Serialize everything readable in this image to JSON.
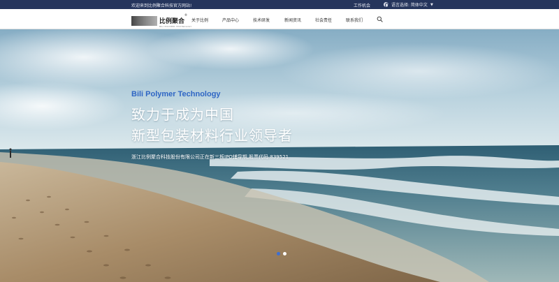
{
  "topbar": {
    "welcome": "欢迎来到比例聚合科技官方网站!",
    "jobs": "工作机会",
    "language": "语言选择: 简体中文",
    "globe_icon": "globe-icon",
    "caret_icon": "chevron-down-icon"
  },
  "logo": {
    "name": "比例聚合",
    "registered": "®",
    "subtitle": "BILI POLYMER TECHNOLOGY"
  },
  "nav": {
    "items": [
      {
        "label": "关于比例"
      },
      {
        "label": "产品中心"
      },
      {
        "label": "技术研发"
      },
      {
        "label": "新闻资讯"
      },
      {
        "label": "社会责任"
      },
      {
        "label": "联系我们"
      }
    ],
    "search_icon": "search-icon"
  },
  "hero": {
    "company_en": "Bili Polymer Technology",
    "line1": "致力于成为中国",
    "line2": "新型包装材料行业领导者",
    "description": "浙江比例聚合科技股份有限公司正在新三板IPO辅导期,股票代码:839521",
    "slides": [
      {
        "active": true
      },
      {
        "active": false
      }
    ]
  },
  "colors": {
    "topbar_bg": "#25355c",
    "accent_blue": "#2f66c4",
    "active_dot": "#3d6fd2"
  }
}
